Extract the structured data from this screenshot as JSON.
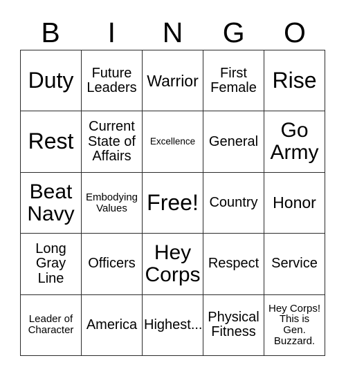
{
  "card": {
    "title": "BINGO Card",
    "headers": [
      "B",
      "I",
      "N",
      "G",
      "O"
    ],
    "free_space": "Free!",
    "colors": {
      "background": "#ffffff",
      "border": "#2b2b2b",
      "text": "#000000"
    },
    "rows": [
      [
        {
          "text": "Duty",
          "size": "xl"
        },
        {
          "text": "Future\nLeaders",
          "size": "sm"
        },
        {
          "text": "Warrior",
          "size": "md"
        },
        {
          "text": "First\nFemale",
          "size": "sm"
        },
        {
          "text": "Rise",
          "size": "xl"
        }
      ],
      [
        {
          "text": "Rest",
          "size": "xl"
        },
        {
          "text": "Current\nState of\nAffairs",
          "size": "sm"
        },
        {
          "text": "Excellence",
          "size": "xxs"
        },
        {
          "text": "General",
          "size": "sm"
        },
        {
          "text": "Go\nArmy",
          "size": "lg"
        }
      ],
      [
        {
          "text": "Beat\nNavy",
          "size": "lg"
        },
        {
          "text": "Embodying\nValues",
          "size": "xs"
        },
        {
          "text": "Free!",
          "size": "xl"
        },
        {
          "text": "Country",
          "size": "sm"
        },
        {
          "text": "Honor",
          "size": "md"
        }
      ],
      [
        {
          "text": "Long\nGray\nLine",
          "size": "sm"
        },
        {
          "text": "Officers",
          "size": "sm"
        },
        {
          "text": "Hey\nCorps",
          "size": "lg"
        },
        {
          "text": "Respect",
          "size": "sm"
        },
        {
          "text": "Service",
          "size": "sm"
        }
      ],
      [
        {
          "text": "Leader of\nCharacter",
          "size": "xs"
        },
        {
          "text": "America",
          "size": "sm"
        },
        {
          "text": "Highest...",
          "size": "sm"
        },
        {
          "text": "Physical\nFitness",
          "size": "sm"
        },
        {
          "text": "Hey Corps!\nThis is\nGen.\nBuzzard.",
          "size": "xs"
        }
      ]
    ]
  }
}
